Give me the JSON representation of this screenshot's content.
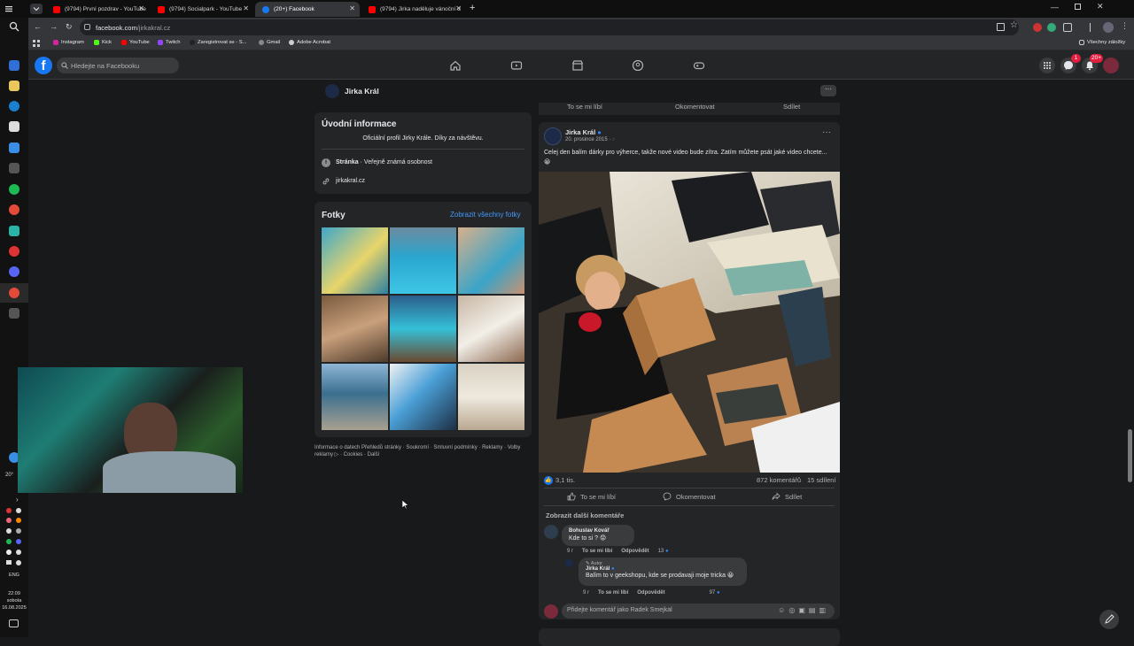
{
  "browser": {
    "tabs": [
      {
        "label": "(9794) První pozdrav - YouTube",
        "active": false,
        "color": "#ff0000"
      },
      {
        "label": "(9794) Socialpark - YouTube",
        "active": false,
        "color": "#ff0000"
      },
      {
        "label": "(20+) Facebook",
        "active": true,
        "color": "#1877f2"
      },
      {
        "label": "(9794) Jirka naděluje vánoční d",
        "active": false,
        "color": "#ff0000"
      }
    ],
    "url_host": "facebook.com",
    "url_path": "/jirkakral.cz",
    "bookmarks": [
      "Instagram",
      "Kick",
      "YouTube",
      "Twitch",
      "Zaregistrovat se - S...",
      "Gmail",
      "Adobe Acrobat"
    ],
    "all_bookmarks": "Všechny záložky"
  },
  "taskbar": {
    "temp": "20°",
    "lang": "ENG",
    "time": "22:09",
    "day": "sobota",
    "date": "16.08.2025"
  },
  "fb": {
    "search_placeholder": "Hledejte na Facebooku",
    "notif_badge_messenger": "1",
    "notif_badge_bell": "20+",
    "page_name": "Jirka Král"
  },
  "intro": {
    "title": "Úvodní informace",
    "bio": "Oficiální profil Jirky Krále. Díky za návštěvu.",
    "page_label": "Stránka",
    "page_type": " · Veřejně známá osobnost",
    "website": "jirkakral.cz"
  },
  "photos": {
    "title": "Fotky",
    "see_all": "Zobrazit všechny fotky"
  },
  "footer_links": "Informace o datech Přehledů stránky · Soukromí · Smluvní podmínky · Reklamy · Volby reklamy ▷ · Cookies · Další",
  "prev_post_actions": {
    "like": "To se mi líbí",
    "comment": "Okomentovat",
    "share": "Sdílet"
  },
  "post": {
    "author": "Jirka Král",
    "date": "20. prosince 2015 ·",
    "text": "Celej den balím dárky pro výherce, takže nové video bude zítra. Zatím můžete psát jaké video chcete... 😀",
    "reactions": "3,1 tis.",
    "comments_count": "872 komentářů",
    "shares_count": "15 sdílení",
    "like": "To se mi líbí",
    "comment": "Okomentovat",
    "share": "Sdílet",
    "more_comments": "Zobrazit další komentáře",
    "comments": [
      {
        "author": "Bohuslav Kovář",
        "text": "Kde to si ? 😟",
        "time": "9 r",
        "like": "To se mi líbí",
        "reply": "Odpovědět",
        "reactions": "13"
      },
      {
        "author": "Jirka Král",
        "badge": "Autor",
        "text": "Balím to v geekshopu, kde se prodavaji moje tricka 😀",
        "time": "9 r",
        "like": "To se mi líbí",
        "reply": "Odpovědět",
        "reactions": "97"
      }
    ],
    "comment_placeholder": "Přidejte komentář jako Radek Smejkal"
  },
  "colors": {
    "fb_blue": "#1877f2",
    "bg": "#18191a",
    "card": "#242526",
    "link": "#4599ff"
  }
}
